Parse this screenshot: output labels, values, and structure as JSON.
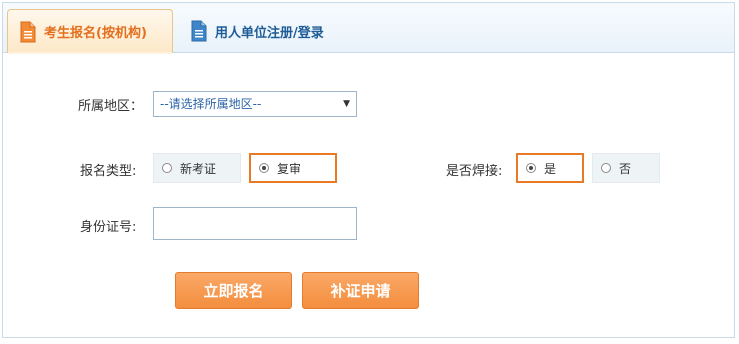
{
  "tabs": [
    {
      "label": "考生报名(按机构)",
      "active": true
    },
    {
      "label": "用人单位注册/登录",
      "active": false
    }
  ],
  "form": {
    "region": {
      "label": "所属地区：",
      "selected": "--请选择所属地区--"
    },
    "type": {
      "label": "报名类型:",
      "options": [
        {
          "label": "新考证",
          "checked": false
        },
        {
          "label": "复审",
          "checked": true
        }
      ]
    },
    "welding": {
      "label": "是否焊接:",
      "options": [
        {
          "label": "是",
          "checked": true
        },
        {
          "label": "否",
          "checked": false
        }
      ]
    },
    "id_number": {
      "label": "身份证号:",
      "value": "",
      "placeholder": ""
    }
  },
  "buttons": {
    "register": "立即报名",
    "reissue": "补证申请"
  },
  "colors": {
    "accent": "#f38e3e",
    "link": "#1d5c97",
    "border": "#c9dbe8"
  },
  "icons": {
    "tab_active": "document-icon",
    "tab_inactive": "document-icon"
  }
}
